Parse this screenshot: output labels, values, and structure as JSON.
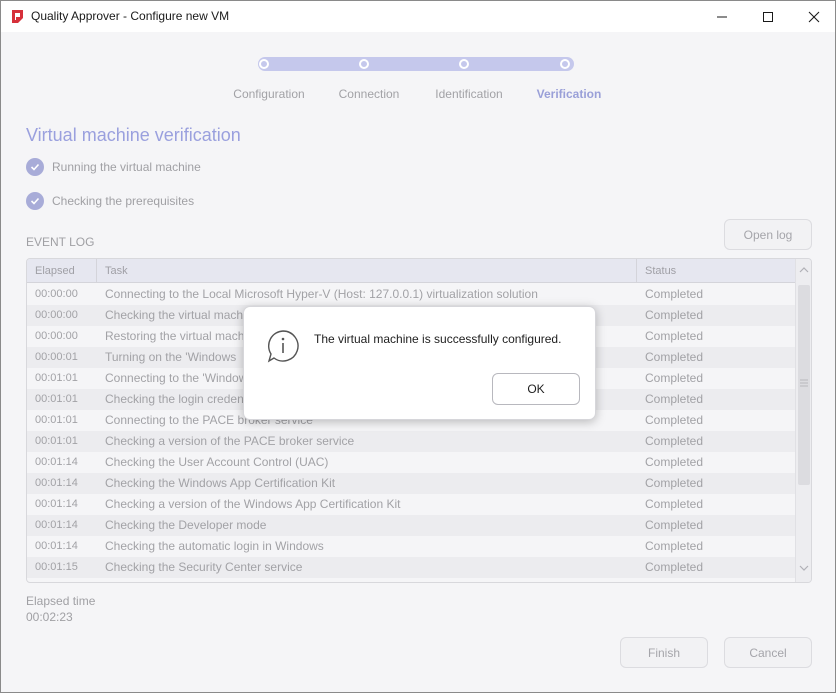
{
  "window": {
    "title": "Quality Approver - Configure new VM",
    "controls": [
      "minimize-icon",
      "maximize-icon",
      "close-icon"
    ]
  },
  "stepper": {
    "steps": [
      {
        "label": "Configuration",
        "active": false
      },
      {
        "label": "Connection",
        "active": false
      },
      {
        "label": "Identification",
        "active": false
      },
      {
        "label": "Verification",
        "active": true
      }
    ]
  },
  "main": {
    "heading": "Virtual machine verification",
    "checks": [
      {
        "label": "Running the virtual machine",
        "icon": "check-icon"
      },
      {
        "label": "Checking the prerequisites",
        "icon": "check-icon"
      }
    ],
    "event_log_label": "EVENT LOG",
    "open_log_button": "Open log"
  },
  "table": {
    "headers": {
      "elapsed": "Elapsed",
      "task": "Task",
      "status": "Status"
    },
    "rows": [
      {
        "elapsed": "00:00:00",
        "task": "Connecting to the Local Microsoft Hyper-V (Host: 127.0.0.1) virtualization solution",
        "status": "Completed"
      },
      {
        "elapsed": "00:00:00",
        "task": "Checking the virtual machine",
        "status": "Completed"
      },
      {
        "elapsed": "00:00:00",
        "task": "Restoring the virtual machine",
        "status": "Completed"
      },
      {
        "elapsed": "00:00:01",
        "task": "Turning on the 'Windows",
        "status": "Completed"
      },
      {
        "elapsed": "00:01:01",
        "task": "Connecting to the 'Windows",
        "status": "Completed"
      },
      {
        "elapsed": "00:01:01",
        "task": "Checking the login credentials",
        "status": "Completed"
      },
      {
        "elapsed": "00:01:01",
        "task": "Connecting to the PACE broker service",
        "status": "Completed"
      },
      {
        "elapsed": "00:01:01",
        "task": "Checking a version of the PACE broker service",
        "status": "Completed"
      },
      {
        "elapsed": "00:01:14",
        "task": "Checking the User Account Control (UAC)",
        "status": "Completed"
      },
      {
        "elapsed": "00:01:14",
        "task": "Checking the Windows App Certification Kit",
        "status": "Completed"
      },
      {
        "elapsed": "00:01:14",
        "task": "Checking a version of the Windows App Certification Kit",
        "status": "Completed"
      },
      {
        "elapsed": "00:01:14",
        "task": "Checking the Developer mode",
        "status": "Completed"
      },
      {
        "elapsed": "00:01:14",
        "task": "Checking the automatic login in Windows",
        "status": "Completed"
      },
      {
        "elapsed": "00:01:15",
        "task": "Checking the Security Center service",
        "status": "Completed"
      }
    ]
  },
  "footer": {
    "elapsed_label": "Elapsed time",
    "elapsed_value": "00:02:23",
    "finish_button": "Finish",
    "cancel_button": "Cancel"
  },
  "dialog": {
    "icon": "info-icon",
    "message": "The virtual machine is successfully configured.",
    "ok_button": "OK"
  },
  "colors": {
    "accent": "#9aa0de",
    "accent_track": "#c5c8ec",
    "check_fill": "#a8acd8",
    "app_icon": "#d6303a"
  }
}
